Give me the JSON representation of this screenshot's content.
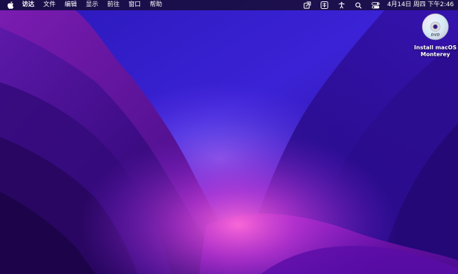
{
  "menubar": {
    "apple_icon": "apple-logo-icon",
    "app_name": "访达",
    "items": [
      "文件",
      "编辑",
      "显示",
      "前往",
      "窗口",
      "帮助"
    ],
    "status_icons": [
      "screen-share-icon",
      "input-method-icon",
      "accessibility-icon",
      "search-icon",
      "control-center-icon"
    ],
    "clock": "4月14日 周四 下午2:46"
  },
  "desktop": {
    "icon_label_line1": "Install macOS",
    "icon_label_line2": "Monterey",
    "disc_text": "DVD"
  },
  "colors": {
    "menubar_bg": "#140c28",
    "wallpaper_dark": "#1a0650",
    "wallpaper_blue": "#3a1fd0",
    "wallpaper_magenta": "#c020c0"
  }
}
